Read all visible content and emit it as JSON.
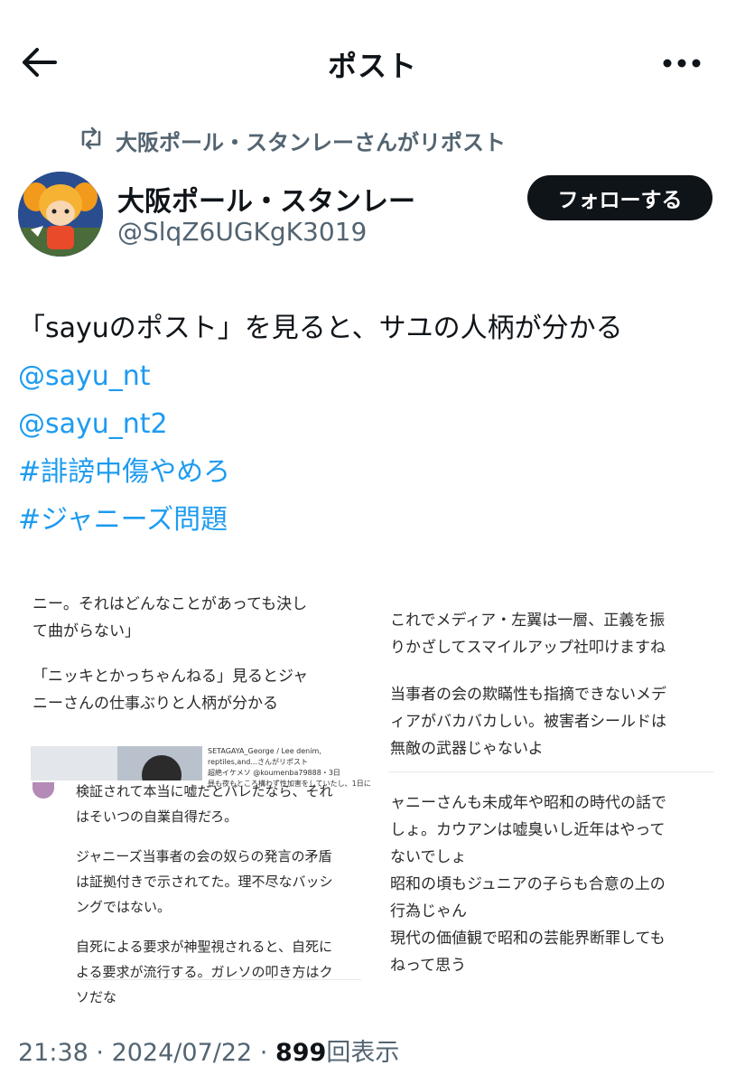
{
  "header": {
    "title": "ポスト"
  },
  "repost": {
    "text": "大阪ポール・スタンレーさんがリポスト"
  },
  "author": {
    "display_name": "大阪ポール・スタンレー",
    "handle": "@SlqZ6UGKgK3019"
  },
  "follow_label": "フォローする",
  "post": {
    "text": "「sayuのポスト」を見ると、サユの人柄が分かる",
    "mentions": [
      "@sayu_nt",
      "@sayu_nt2"
    ],
    "hashtags": [
      "#誹謗中傷やめろ",
      "#ジャニーズ問題"
    ]
  },
  "media": {
    "left_top_lines": [
      "ニー。それはどんなことがあっても決し",
      "て曲がらない」",
      "",
      "「ニッキとかっちゃんねる」見るとジャ",
      "ニーさんの仕事ぶりと人柄が分かる"
    ],
    "quote_meta": "SETAGAYA_George / Lee denim, reptiles,and...さんがリポスト",
    "quote_user": "超絶イケメソ @koumenba79888・3日",
    "quote_snippet": "昼も夜もところ構わず性加害をしていたし、1日に",
    "left_bottom_lines": [
      "検証されて本当に嘘だとバレたなら、それ",
      "はそいつの自業自得だろ。",
      "",
      "ジャニーズ当事者の会の奴らの発言の矛盾",
      "は証拠付きで示されてた。理不尽なバッシ",
      "ングではない。",
      "",
      "自死による要求が神聖視されると、自死に",
      "よる要求が流行する。ガレソの叩き方はク",
      "ソだな"
    ],
    "right_top_lines": [
      "これでメディア・左翼は一層、正義を振",
      "りかざしてスマイルアップ社叩けますね",
      "",
      "当事者の会の欺瞞性も指摘できないメデ",
      "ィアがバカバカしい。被害者シールドは",
      "無敵の武器じゃないよ"
    ],
    "right_bottom_lines": [
      "ャニーさんも未成年や昭和の時代の話で",
      "しょ。カウアンは嘘臭いし近年はやって",
      "ないでしょ",
      "昭和の頃もジュニアの子らも合意の上の",
      "行為じゃん",
      "現代の価値観で昭和の芸能界断罪しても",
      "ねって思う"
    ]
  },
  "footer": {
    "time": "21:38",
    "date": "2024/07/22",
    "views": "899",
    "views_label": "回表示"
  }
}
